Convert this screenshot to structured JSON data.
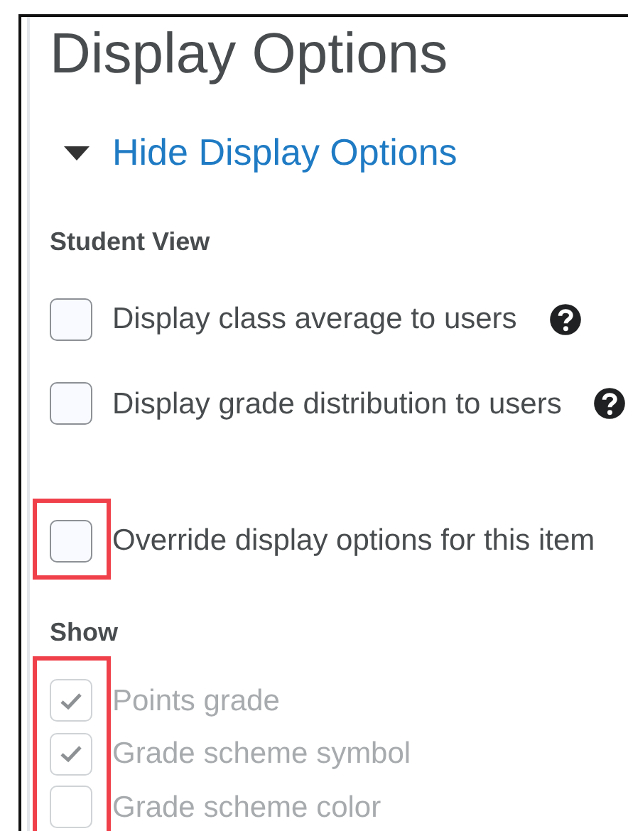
{
  "heading": "Display Options",
  "toggle": {
    "label": "Hide Display Options",
    "expanded": true
  },
  "student_view": {
    "title": "Student View",
    "options": [
      {
        "label": "Display class average to users",
        "checked": false,
        "help": true
      },
      {
        "label": "Display grade distribution to users",
        "checked": false,
        "help": true
      }
    ]
  },
  "override": {
    "label": "Override display options for this item",
    "checked": false,
    "highlighted": true
  },
  "show": {
    "title": "Show",
    "highlighted": true,
    "options": [
      {
        "label": "Points grade",
        "checked": true,
        "disabled": true
      },
      {
        "label": "Grade scheme symbol",
        "checked": true,
        "disabled": true
      },
      {
        "label": "Grade scheme color",
        "checked": false,
        "disabled": true
      }
    ]
  }
}
